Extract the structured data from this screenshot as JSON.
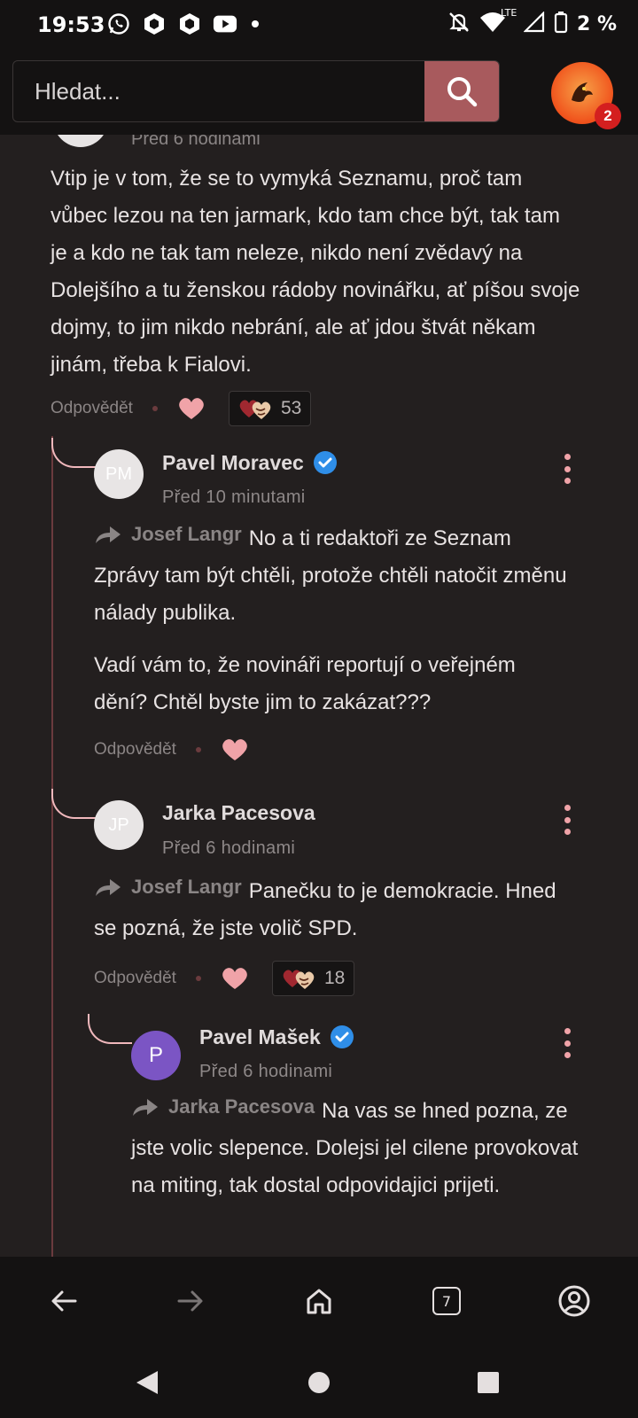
{
  "status_bar": {
    "time": "19:53",
    "battery": "2 %",
    "network_label": "LTE",
    "icons_left": [
      "whatsapp-icon",
      "app-icon",
      "app-icon",
      "youtube-icon",
      "dot-icon"
    ],
    "icons_right": [
      "mute-icon",
      "wifi-icon",
      "signal-icon",
      "battery-icon"
    ]
  },
  "header": {
    "search_placeholder": "Hledat...",
    "notification_count": "2",
    "accent_color": "#a85a5d"
  },
  "ghost_comment": {
    "time": "Před 6 hodinami"
  },
  "main_comment": {
    "text": "Vtip je v tom, že se to vymyká Seznamu, proč tam vůbec lezou na ten jarmark, kdo tam chce být, tak tam je a kdo ne tak tam neleze, nikdo není zvědavý na Dolejšího a tu ženskou rádoby novinářku, ať píšou svoje dojmy, to jim nikdo nebrání, ale ať jdou štvát někam jinám, třeba k Fialovi.",
    "reply_label": "Odpovědět",
    "reaction_count": "53"
  },
  "replies": [
    {
      "initials": "PM",
      "author": "Pavel Moravec",
      "verified": true,
      "time": "Před 10 minutami",
      "reply_to": "Josef Langr",
      "text1": "No a ti redaktoři ze Seznam Zprávy tam být chtěli, protože chtěli natočit změnu nálady publika.",
      "text2": "Vadí vám to, že novináři reportují o veřejném dění? Chtěl byste jim to zakázat???",
      "reply_label": "Odpovědět"
    },
    {
      "initials": "JP",
      "author": "Jarka Pacesova",
      "verified": false,
      "time": "Před 6 hodinami",
      "reply_to": "Josef Langr",
      "text1": "Panečku to je demokracie. Hned se pozná, že jste volič SPD.",
      "reply_label": "Odpovědět",
      "reaction_count": "18"
    },
    {
      "initials": "P",
      "author": "Pavel Mašek",
      "verified": true,
      "time": "Před 6 hodinami",
      "reply_to": "Jarka Pacesova",
      "text1": "Na vas se hned pozna, ze jste volic slepence. Dolejsi jel cilene provokovat na miting, tak dostal odpovidajici prijeti."
    }
  ],
  "browser_bar": {
    "tab_count": "7",
    "buttons": [
      "back-arrow-icon",
      "forward-arrow-icon",
      "home-icon",
      "tabs-icon",
      "account-icon"
    ]
  },
  "system_nav": [
    "nav-back-icon",
    "nav-home-icon",
    "nav-recents-icon"
  ]
}
